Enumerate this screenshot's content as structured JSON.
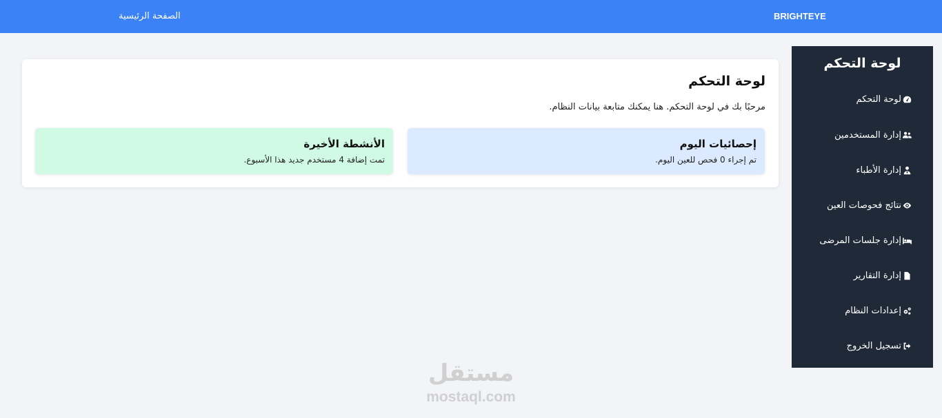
{
  "topbar": {
    "home_link": "الصفحة الرئيسية",
    "brand": "BRIGHTEYE",
    "color": "#3b82f6"
  },
  "sidebar": {
    "title": "لوحة التحكم",
    "background": "#1f2937",
    "items": [
      {
        "label": "لوحة التحكم",
        "icon": "dashboard-gauge-icon"
      },
      {
        "label": "إدارة المستخدمين",
        "icon": "users-icon"
      },
      {
        "label": "إدارة الأطباء",
        "icon": "doctor-icon"
      },
      {
        "label": "نتائج فحوصات العين",
        "icon": "eye-icon"
      },
      {
        "label": "إدارة جلسات المرضى",
        "icon": "bed-icon"
      },
      {
        "label": "إدارة التقارير",
        "icon": "file-icon"
      },
      {
        "label": "إعدادات النظام",
        "icon": "gears-icon"
      },
      {
        "label": "تسجيل الخروج",
        "icon": "sign-out-icon"
      }
    ]
  },
  "main": {
    "title": "لوحة التحكم",
    "subtitle": "مرحبًا بك في لوحة التحكم. هنا يمكنك متابعة بيانات النظام.",
    "cards": {
      "today": {
        "title": "إحصائيات اليوم",
        "text": "تم إجراء 0 فحص للعين اليوم.",
        "color": "#dbeafe"
      },
      "recent": {
        "title": "الأنشطة الأخيرة",
        "text": "تمت إضافة 4 مستخدم جديد هذا الأسبوع.",
        "color": "#d1fae5"
      }
    }
  },
  "watermark": {
    "arabic": "مستقل",
    "latin": "mostaql.com"
  }
}
